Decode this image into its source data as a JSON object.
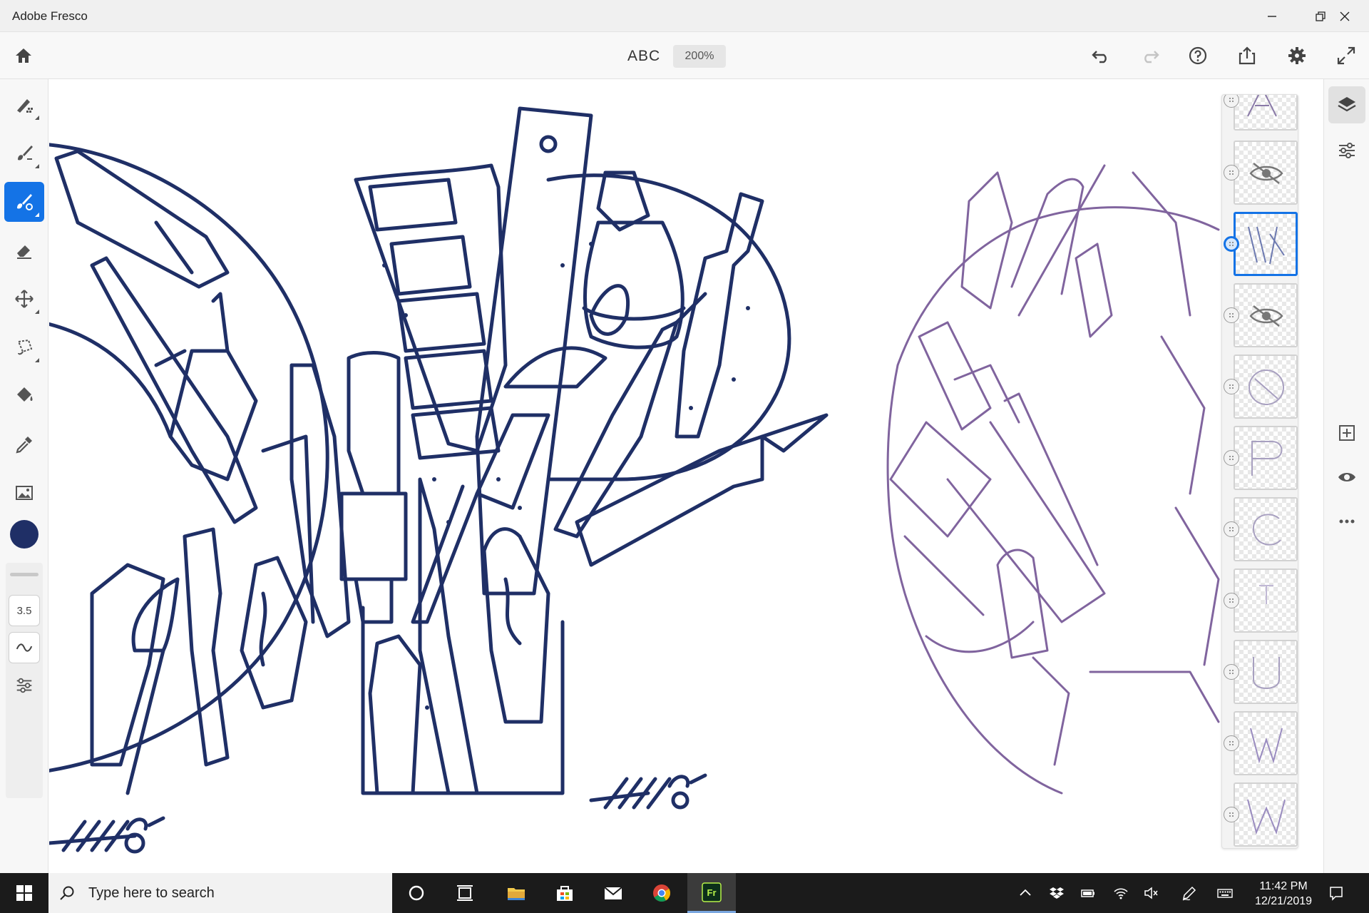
{
  "window": {
    "title": "Adobe Fresco",
    "controls": [
      "minimize-icon",
      "maximize-icon",
      "close-icon"
    ]
  },
  "toolbar": {
    "doc_title": "ABC",
    "zoom": "200%",
    "left_icons": [
      "home-icon"
    ],
    "right_icons": [
      "undo-icon",
      "redo-icon",
      "help-icon",
      "share-icon",
      "settings-icon",
      "fullscreen-icon"
    ]
  },
  "tools": [
    {
      "name": "pixel-brush",
      "icon": "pixel-brush-icon",
      "active": false
    },
    {
      "name": "live-brush",
      "icon": "live-brush-icon",
      "active": false
    },
    {
      "name": "vector-brush",
      "icon": "vector-brush-icon",
      "active": true
    },
    {
      "name": "eraser",
      "icon": "eraser-icon",
      "active": false
    },
    {
      "name": "transform",
      "icon": "move-icon",
      "active": false
    },
    {
      "name": "selection",
      "icon": "lasso-icon",
      "active": false
    },
    {
      "name": "fill",
      "icon": "paint-bucket-icon",
      "active": false
    },
    {
      "name": "eyedropper",
      "icon": "eyedropper-icon",
      "active": false
    },
    {
      "name": "place-image",
      "icon": "image-icon",
      "active": false
    }
  ],
  "brush": {
    "color": "#1f2f66",
    "size": "3.5"
  },
  "layers": {
    "count_visible": 11,
    "selected_index": 2,
    "hidden_indices": [
      1,
      3
    ]
  },
  "right_rail": [
    "layers-icon",
    "layer-properties-icon",
    "add-layer-icon",
    "visibility-icon",
    "more-icon"
  ],
  "taskbar": {
    "search_placeholder": "Type here to search",
    "time": "11:42 PM",
    "date": "12/21/2019",
    "fresco_label": "Fr"
  },
  "colors": {
    "accent": "#1473e6",
    "ink": "#1f2f66",
    "sketch": "#6b4a8e"
  }
}
